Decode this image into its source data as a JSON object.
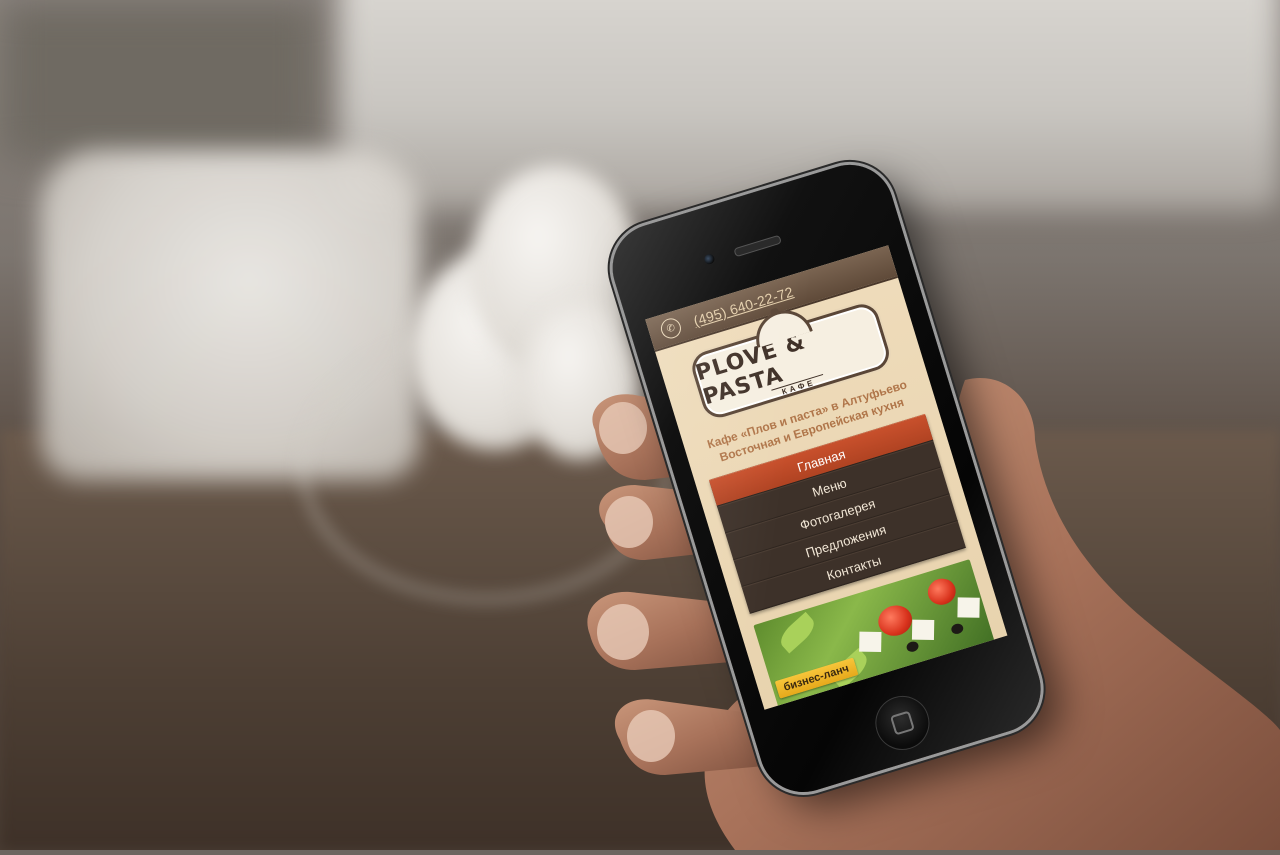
{
  "site": {
    "phone_icon": "phone-icon",
    "phone_number": "(495) 640-22-72",
    "logo": {
      "title": "PLOVE & PASTA",
      "subtitle": "КАФЕ"
    },
    "tagline": {
      "line1": "Кафе «Плов и паста» в Алтуфьево",
      "line2": "Восточная и Европейская кухня"
    },
    "nav": {
      "items": [
        {
          "label": "Главная",
          "active": true
        },
        {
          "label": "Меню"
        },
        {
          "label": "Фотогалерея"
        },
        {
          "label": "Предложения"
        },
        {
          "label": "Контакты"
        }
      ]
    },
    "promo": {
      "badge": "бизнес-ланч"
    }
  },
  "colors": {
    "accent": "#c8502c",
    "nav_bg": "#3d3129",
    "topbar": "#6b5442",
    "page_bg": "#efdcbb",
    "tagline": "#b0764a",
    "badge": "#f2b72a"
  }
}
